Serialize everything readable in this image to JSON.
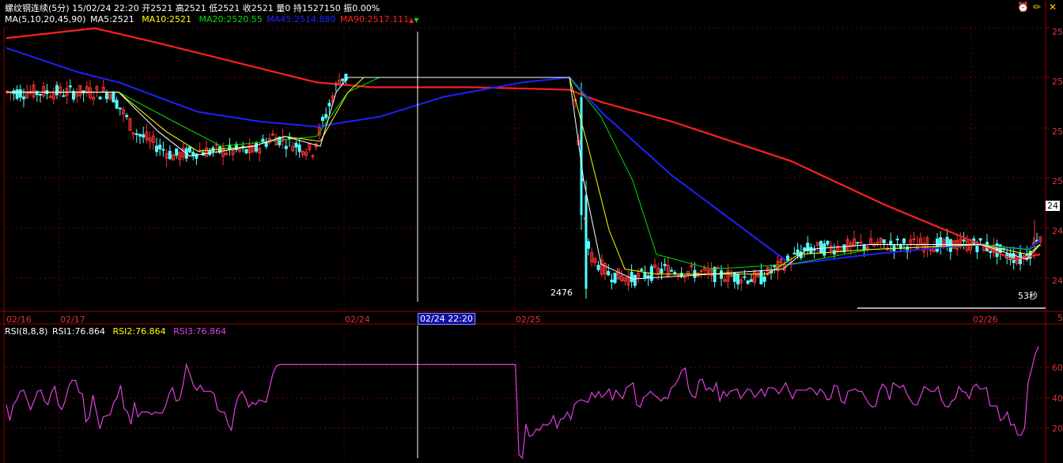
{
  "header": {
    "symbol": "螺纹钢连续",
    "period": "(5分)",
    "time": "15/02/24 22:20",
    "open": "开2521",
    "high": "高2521",
    "low": "低2521",
    "close": "收2521",
    "volume": "量0",
    "position": "持1527150",
    "amplitude": "振0.00%"
  },
  "ma_legend": {
    "label": "MA(5,10,20,45,90)",
    "ma5": "MA5:2521",
    "ma10": "MA10:2521",
    "ma20": "MA20:2520.55",
    "ma45": "MA45:2514.889",
    "ma90": "MA90:2517.111",
    "ma90_arrow": "▲",
    "end_arrow": "▼"
  },
  "rsi_legend": {
    "label": "RSI(8,8,8)",
    "rsi1": "RSI1:76.864",
    "rsi2": "RSI2:76.864",
    "rsi3": "RSI3:76.864"
  },
  "annotations": {
    "low_price": "2476",
    "countdown": "53秒",
    "current_price_tag": "24"
  },
  "cursor_date": "02/24 22:20",
  "x_dates": [
    {
      "label": "02/16"
    },
    {
      "label": "02/17"
    },
    {
      "label": "02/24"
    },
    {
      "label": "02/25"
    },
    {
      "label": "02/26"
    }
  ],
  "price_axis_labels": [
    "25",
    "25",
    "25",
    "25",
    "24",
    "24"
  ],
  "rsi_axis_labels": [
    "60",
    "40",
    "20"
  ],
  "volume_axis_label": "5",
  "colors": {
    "up": "#ff3232",
    "down": "#54ffff",
    "ma5": "#ffffff",
    "ma10": "#ffff00",
    "ma20": "#00e000",
    "ma45": "#2020ff",
    "ma90": "#ff2020",
    "rsi": "#e040e0",
    "grid": "#a00000"
  },
  "chart_data": [
    {
      "type": "candlestick",
      "title": "螺纹钢连续 (5分)",
      "y_note": "price",
      "lowest_label": 2476,
      "series": [
        {
          "name": "MA5",
          "last": 2521
        },
        {
          "name": "MA10",
          "last": 2521
        },
        {
          "name": "MA20",
          "last": 2520.55
        },
        {
          "name": "MA45",
          "last": 2514.889
        },
        {
          "name": "MA90",
          "last": 2517.111
        }
      ],
      "x_ticks": [
        "02/16",
        "02/17",
        "02/24",
        "02/25",
        "02/26"
      ]
    },
    {
      "type": "line",
      "title": "RSI(8,8,8)",
      "ylim": [
        0,
        100
      ],
      "y_ticks": [
        20,
        40,
        60
      ],
      "series": [
        {
          "name": "RSI3",
          "values": [
            44,
            31,
            44,
            48,
            55,
            56,
            48,
            40,
            47,
            55,
            56,
            47,
            44,
            54,
            59,
            44,
            40,
            47,
            59,
            64,
            64,
            54,
            53,
            30,
            34,
            52,
            38,
            24,
            34,
            35,
            36,
            46,
            50,
            60,
            41,
            38,
            28,
            46,
            34,
            38,
            38,
            38,
            36,
            38,
            37,
            37,
            43,
            53,
            58,
            47,
            48,
            60,
            77,
            69,
            60,
            56,
            60,
            55,
            55,
            55,
            53,
            40,
            38,
            38,
            28,
            23,
            41,
            51,
            55,
            50,
            42,
            46,
            44,
            48,
            47,
            46,
            58,
            70,
            76,
            77,
            77,
            77,
            77,
            77,
            77,
            77,
            77,
            77,
            77,
            77,
            77,
            77,
            77,
            77,
            77,
            77,
            77,
            77,
            77,
            77,
            77,
            77,
            77,
            77,
            77,
            77,
            77,
            77,
            77,
            77,
            77,
            77,
            77,
            77,
            77,
            77,
            77,
            77,
            77,
            77,
            77,
            77,
            77,
            77,
            77,
            77,
            77,
            77,
            77,
            77,
            77,
            77,
            77,
            77,
            77,
            77,
            77,
            77,
            77,
            77,
            77,
            77,
            77,
            77,
            77,
            77,
            77,
            77,
            3,
            0,
            28,
            18,
            19,
            24,
            23,
            28,
            27,
            29,
            35,
            25,
            32,
            33,
            38,
            32,
            44,
            47,
            48,
            47,
            46,
            54,
            50,
            55,
            50,
            53,
            57,
            48,
            56,
            52,
            49,
            58,
            60,
            62,
            44,
            42,
            50,
            52,
            55,
            52,
            50,
            47,
            50,
            49,
            58,
            60,
            65,
            72,
            74,
            57,
            51,
            50,
            64,
            65,
            56,
            58,
            55,
            62,
            47,
            55,
            51,
            55,
            56,
            57,
            49,
            53,
            57,
            56,
            50,
            53,
            57,
            51,
            58,
            58,
            57,
            53,
            57,
            62,
            55,
            49,
            56,
            56,
            56,
            56,
            58,
            56,
            52,
            57,
            54,
            48,
            49,
            60,
            59,
            47,
            45,
            55,
            56,
            57,
            55,
            55,
            50,
            45,
            42,
            43,
            55,
            61,
            58,
            48,
            62,
            60,
            58,
            60,
            53,
            48,
            44,
            44,
            51,
            59,
            57,
            55,
            55,
            59,
            48,
            43,
            42,
            47,
            49,
            59,
            55,
            54,
            49,
            58,
            61,
            57,
            57,
            58,
            43,
            43,
            43,
            31,
            33,
            38,
            27,
            28,
            19,
            19,
            25,
            62,
            73,
            85,
            92
          ]
        }
      ]
    }
  ]
}
